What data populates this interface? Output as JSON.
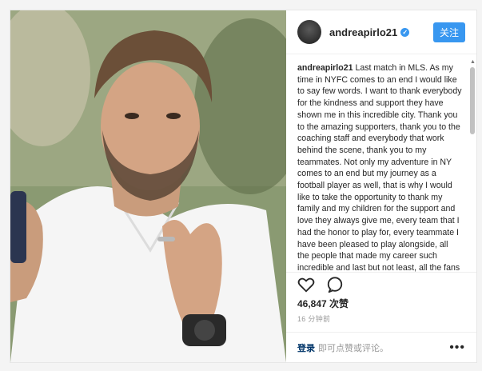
{
  "header": {
    "username": "andreapirlo21",
    "follow_label": "关注",
    "verified_icon": "verified-badge-icon"
  },
  "caption": {
    "username": "andreapirlo21",
    "text": "Last match in MLS. As my time in NYFC comes to an end I would like to say few words. I want to thank everybody for the kindness and support they have shown me in this incredible city. Thank you to the amazing supporters, thank you to the coaching staff and everybody that work behind the scene, thank you to my teammates. Not only my adventure in NY comes to an end but my journey as a football player as well, that is why I would like to take the opportunity to thank my family and my children for the support and love they always give me, every team that I had the honor to play for, every teammate I have been pleased to play alongside, all the people that made my career such incredible and last but not least, all the fans around the world that always showed me support. You will always"
  },
  "actions": {
    "like_icon": "heart-icon",
    "comment_icon": "comment-icon"
  },
  "likes": {
    "text": "46,847 次赞"
  },
  "time": {
    "text": "16 分钟前"
  },
  "comment_bar": {
    "login_label": "登录",
    "prompt": "即可点赞或评论。",
    "more_label": "•••"
  },
  "colors": {
    "accent": "#3897f0",
    "link": "#003569"
  }
}
